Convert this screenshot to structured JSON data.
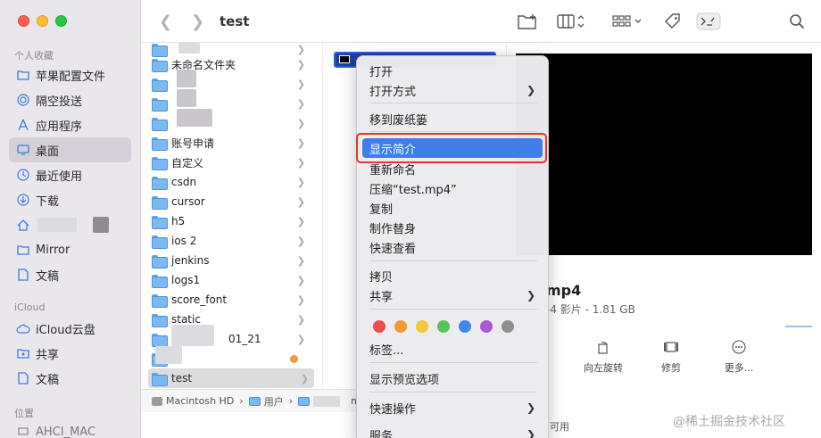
{
  "window": {
    "title": "test"
  },
  "sidebar": {
    "favorites_header": "个人收藏",
    "favorites": [
      {
        "label": "苹果配置文件",
        "icon": "folder-icon"
      },
      {
        "label": "隔空投送",
        "icon": "airdrop-icon"
      },
      {
        "label": "应用程序",
        "icon": "applications-icon"
      },
      {
        "label": "桌面",
        "icon": "desktop-icon",
        "active": true
      },
      {
        "label": "最近使用",
        "icon": "recents-icon"
      },
      {
        "label": "下载",
        "icon": "downloads-icon"
      },
      {
        "label": "",
        "icon": "home-icon"
      },
      {
        "label": "Mirror",
        "icon": "folder-icon"
      },
      {
        "label": "文稿",
        "icon": "document-icon"
      }
    ],
    "icloud_header": "iCloud",
    "icloud": [
      {
        "label": "iCloud云盘",
        "icon": "cloud-icon"
      },
      {
        "label": "共享",
        "icon": "shared-folder-icon"
      },
      {
        "label": "文稿",
        "icon": "document-icon"
      }
    ],
    "locations_header": "位置",
    "locations": [
      {
        "label": "AHCI_MAC",
        "icon": "laptop-icon"
      }
    ]
  },
  "folders": [
    {
      "label": "",
      "chevron": true
    },
    {
      "label": "未命名文件夹",
      "chevron": true
    },
    {
      "label": "",
      "chevron": true
    },
    {
      "label": "",
      "chevron": true
    },
    {
      "label": "",
      "chevron": true
    },
    {
      "label": "账号申请",
      "chevron": true
    },
    {
      "label": "自定义",
      "chevron": true
    },
    {
      "label": "csdn",
      "chevron": true
    },
    {
      "label": "cursor",
      "chevron": true
    },
    {
      "label": "h5",
      "chevron": true
    },
    {
      "label": "ios 2",
      "chevron": true
    },
    {
      "label": "jenkins",
      "chevron": true
    },
    {
      "label": "logs1",
      "chevron": true
    },
    {
      "label": "score_font",
      "chevron": true
    },
    {
      "label": "static",
      "chevron": true
    },
    {
      "label": "01_21",
      "chevron": true
    },
    {
      "label": "",
      "chevron": false,
      "tag": "orange"
    },
    {
      "label": "test",
      "chevron": true,
      "selected": true
    }
  ],
  "pathbar": [
    "Macintosh HD",
    "用户",
    "",
    "mac"
  ],
  "preview": {
    "name": "mp4",
    "meta": "-4 影片 - 1.81 GB",
    "actions": [
      {
        "label": "向左旋转",
        "icon": "rotate-left-icon"
      },
      {
        "label": "修剪",
        "icon": "trim-icon"
      },
      {
        "label": "更多...",
        "icon": "more-icon"
      }
    ],
    "available": "可用"
  },
  "context_menu": {
    "items": [
      {
        "label": "打开",
        "arrow": false
      },
      {
        "label": "打开方式",
        "arrow": true
      },
      {
        "sep": true
      },
      {
        "label": "移到废纸篓",
        "arrow": false
      },
      {
        "sep": true
      },
      {
        "label": "显示简介",
        "arrow": false,
        "highlighted": true
      },
      {
        "label": "重新命名",
        "arrow": false
      },
      {
        "label": "压缩“test.mp4”",
        "arrow": false
      },
      {
        "label": "复制",
        "arrow": false
      },
      {
        "label": "制作替身",
        "arrow": false
      },
      {
        "label": "快速查看",
        "arrow": false
      },
      {
        "sep": true
      },
      {
        "label": "拷贝",
        "arrow": false
      },
      {
        "label": "共享",
        "arrow": true
      },
      {
        "sep": true
      },
      {
        "tags": true
      },
      {
        "label": "标签...",
        "arrow": false
      },
      {
        "sep": true
      },
      {
        "label": "显示预览选项",
        "arrow": false
      },
      {
        "sep": true
      },
      {
        "label": "快速操作",
        "arrow": true
      },
      {
        "label": "服务",
        "arrow": true
      }
    ],
    "tag_colors": [
      "#ef4d4b",
      "#f19a37",
      "#f0c83a",
      "#54c45b",
      "#3f86ee",
      "#a95ad2",
      "#8e8e8e"
    ]
  },
  "watermark": "@稀土掘金技术社区"
}
